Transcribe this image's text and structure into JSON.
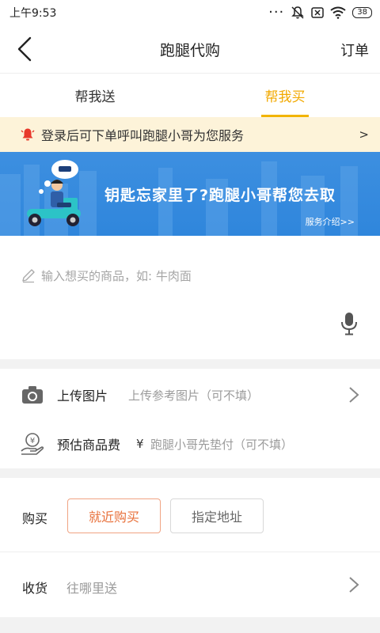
{
  "status_bar": {
    "time": "上午9:53",
    "battery": "38"
  },
  "nav": {
    "title": "跑腿代购",
    "orders_label": "订单"
  },
  "tabs": [
    {
      "label": "帮我送",
      "active": false
    },
    {
      "label": "帮我买",
      "active": true
    }
  ],
  "notice": {
    "text": "登录后可下单呼叫跑腿小哥为您服务",
    "arrow": ">"
  },
  "banner": {
    "slogan": "钥匙忘家里了?跑腿小哥帮您去取",
    "link": "服务介绍>>"
  },
  "item_input": {
    "placeholder": "输入想买的商品，如: 牛肉面",
    "icon": "pencil-icon",
    "voice_icon": "microphone-icon"
  },
  "upload": {
    "label": "上传图片",
    "hint": "上传参考图片（可不填）",
    "icon": "camera-icon"
  },
  "estimate": {
    "label": "预估商品费",
    "currency": "¥",
    "hint": "跑腿小哥先垫付（可不填）",
    "icon": "money-hand-icon"
  },
  "purchase": {
    "label": "购买",
    "options": [
      {
        "label": "就近购买",
        "selected": true
      },
      {
        "label": "指定地址",
        "selected": false
      }
    ]
  },
  "receive": {
    "label": "收货",
    "hint": "往哪里送"
  },
  "colors": {
    "accent": "#f2a900",
    "notice_bg": "#fdf3d9",
    "banner_bg": "#2f86dc",
    "selected_option": "#e8703a",
    "alert_red": "#e8382b"
  }
}
